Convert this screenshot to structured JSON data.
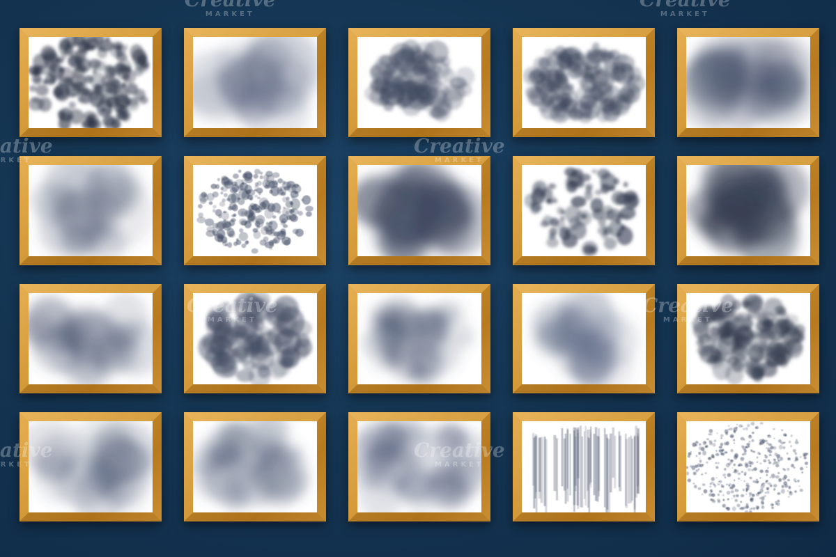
{
  "watermark": {
    "line1": "Creative",
    "line2": "MARKET"
  },
  "colors": {
    "background": "#153654",
    "frame_gold": "#cf9230",
    "canvas_white": "#ffffff",
    "texture_slate": "#4a5570"
  },
  "textures": [
    {
      "name": "texture-swatch-1",
      "style": "grainy-heavy"
    },
    {
      "name": "texture-swatch-2",
      "style": "soft-haze"
    },
    {
      "name": "texture-swatch-3",
      "style": "mottled-cloud"
    },
    {
      "name": "texture-swatch-4",
      "style": "rough-smudge"
    },
    {
      "name": "texture-swatch-5",
      "style": "soft-blot"
    },
    {
      "name": "texture-swatch-6",
      "style": "diagonal-haze"
    },
    {
      "name": "texture-swatch-7",
      "style": "speckled-grain"
    },
    {
      "name": "texture-swatch-8",
      "style": "dense-blot"
    },
    {
      "name": "texture-swatch-9",
      "style": "splatter"
    },
    {
      "name": "texture-swatch-10",
      "style": "dark-blot"
    },
    {
      "name": "texture-swatch-11",
      "style": "canvas-haze"
    },
    {
      "name": "texture-swatch-12",
      "style": "cloud-clusters"
    },
    {
      "name": "texture-swatch-13",
      "style": "soft-mottle"
    },
    {
      "name": "texture-swatch-14",
      "style": "light-haze"
    },
    {
      "name": "texture-swatch-15",
      "style": "dark-grain"
    },
    {
      "name": "texture-swatch-16",
      "style": "corner-haze"
    },
    {
      "name": "texture-swatch-17",
      "style": "light-blot"
    },
    {
      "name": "texture-swatch-18",
      "style": "cloudy-wash"
    },
    {
      "name": "texture-swatch-19",
      "style": "vertical-streaks"
    },
    {
      "name": "texture-swatch-20",
      "style": "fine-glitter"
    }
  ]
}
